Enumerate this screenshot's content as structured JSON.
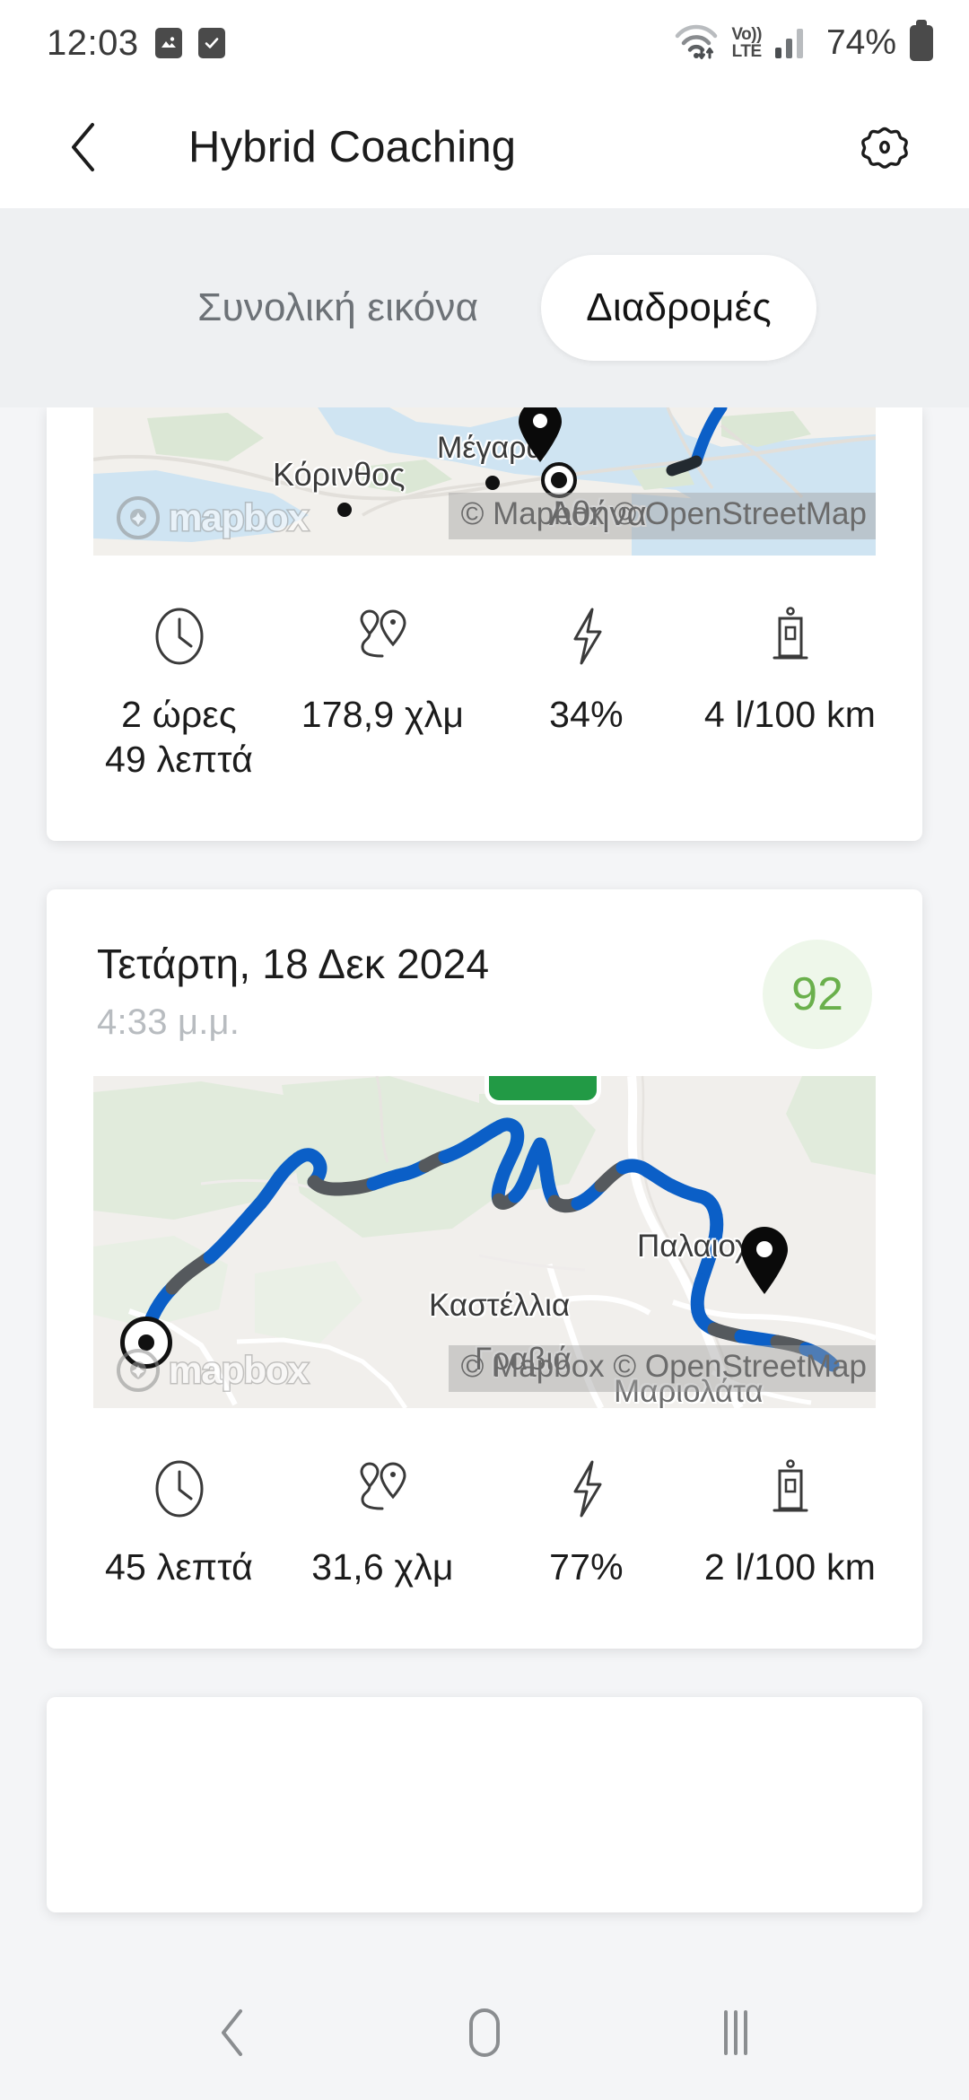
{
  "status_bar": {
    "clock": "12:03",
    "left_icons": [
      "image-icon",
      "checkbox-icon"
    ],
    "network": {
      "wifi": "wifi-icon",
      "volte_top": "Vo))",
      "volte_bottom": "LTE",
      "signal": "signal-bars-icon"
    },
    "battery_percent": "74%",
    "battery_icon": "battery-icon"
  },
  "header": {
    "back_icon": "chevron-left-icon",
    "title": "Hybrid Coaching",
    "settings_icon": "gear-icon"
  },
  "tabs": [
    {
      "label": "Συνολική εικόνα",
      "active": false
    },
    {
      "label": "Διαδρομές",
      "active": true
    }
  ],
  "trips": [
    {
      "clipped_top": true,
      "map": {
        "attribution": "© Mapbox © OpenStreetMap",
        "logo_text": "mapbox",
        "labels": [
          "Κόρινθος",
          "Μέγαρα",
          "Αθήνα"
        ],
        "start_marker": "route-start-marker",
        "end_marker": "route-end-pin"
      },
      "stats": [
        {
          "icon": "clock-icon",
          "value": "2 ώρες\n49 λεπτά"
        },
        {
          "icon": "route-pins-icon",
          "value": "178,9 χλμ"
        },
        {
          "icon": "lightning-bolt-icon",
          "value": "34%"
        },
        {
          "icon": "fuel-pump-icon",
          "value": "4 l/100 km"
        }
      ]
    },
    {
      "clipped_top": false,
      "date": "Τετάρτη, 18 Δεκ 2024",
      "time": "4:33 μ.μ.",
      "score": "92",
      "map": {
        "attribution": "© Mapbox © OpenStreetMap",
        "logo_text": "mapbox",
        "labels": [
          "Παλαιοχώ",
          "Καστέλλια",
          "Γραβιά",
          "Μαριολάτα"
        ],
        "start_marker": "route-start-marker",
        "end_marker": "route-end-pin"
      },
      "stats": [
        {
          "icon": "clock-icon",
          "value": "45 λεπτά"
        },
        {
          "icon": "route-pins-icon",
          "value": "31,6 χλμ"
        },
        {
          "icon": "lightning-bolt-icon",
          "value": "77%"
        },
        {
          "icon": "fuel-pump-icon",
          "value": "2 l/100 km"
        }
      ]
    }
  ],
  "nav_bar": {
    "back": "nav-back-icon",
    "home": "nav-home-icon",
    "recents": "nav-recents-icon"
  },
  "colors": {
    "route_blue": "#0b5fc7",
    "route_gray": "#55595d",
    "score_green": "#6ab04c",
    "score_bg": "#eef7ea",
    "page_bg": "#f4f5f7",
    "tabbar_bg": "#eef0f2",
    "highway_green": "#229a45"
  }
}
